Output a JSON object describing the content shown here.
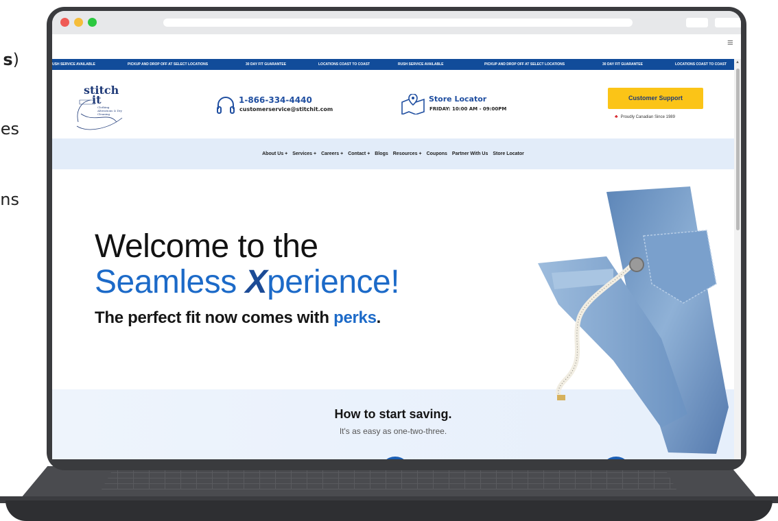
{
  "fragments": {
    "line1_bold": "s",
    "line1_paren": ")",
    "line2": "es",
    "line3": "ns"
  },
  "ticker": {
    "items": [
      "USH SERVICE AVAILABLE",
      "PICKUP AND DROP OFF AT SELECT LOCATIONS",
      "30 DAY FIT GUARANTEE",
      "LOCATIONS COAST TO COAST",
      "RUSH SERVICE AVAILABLE",
      "PICKUP AND DROP OFF AT SELECT LOCATIONS",
      "30 DAY FIT GUARANTEE",
      "LOCATIONS COAST TO COAST"
    ]
  },
  "header": {
    "logo_line1": "stitch",
    "logo_line2": "it",
    "logo_tagline": "Clothing Alterations & Dry Cleaning",
    "phone": "1-866-334-4440",
    "email": "customerservice@stitchit.com",
    "store_title": "Store Locator",
    "store_hours": "FRIDAY: 10:00 AM - 09:00PM",
    "support_button": "Customer Support",
    "canada_text": "Proudly Canadian Since 1989"
  },
  "nav": {
    "items": [
      "About Us +",
      "Services +",
      "Careers +",
      "Contact +",
      "Blogs",
      "Resources +",
      "Coupons",
      "Partner With Us",
      "Store Locator"
    ]
  },
  "hero": {
    "line1": "Welcome to the",
    "line2_a": "Seamless ",
    "line2_x": "X",
    "line2_b": "perience!",
    "sub_a": "The perfect fit now comes with ",
    "sub_b": "perks",
    "sub_c": "."
  },
  "saving": {
    "title": "How to start saving.",
    "subtitle": "It's as easy as one-two-three."
  },
  "colors": {
    "brand_blue": "#1c6ac8",
    "ticker_blue": "#114c9a",
    "support_yellow": "#fbc417",
    "nav_band": "#e2ecf9"
  },
  "icons": {
    "phone": "headphones-icon",
    "store": "map-pin-icon",
    "canada": "maple-leaf-icon",
    "menu": "hamburger-icon"
  }
}
